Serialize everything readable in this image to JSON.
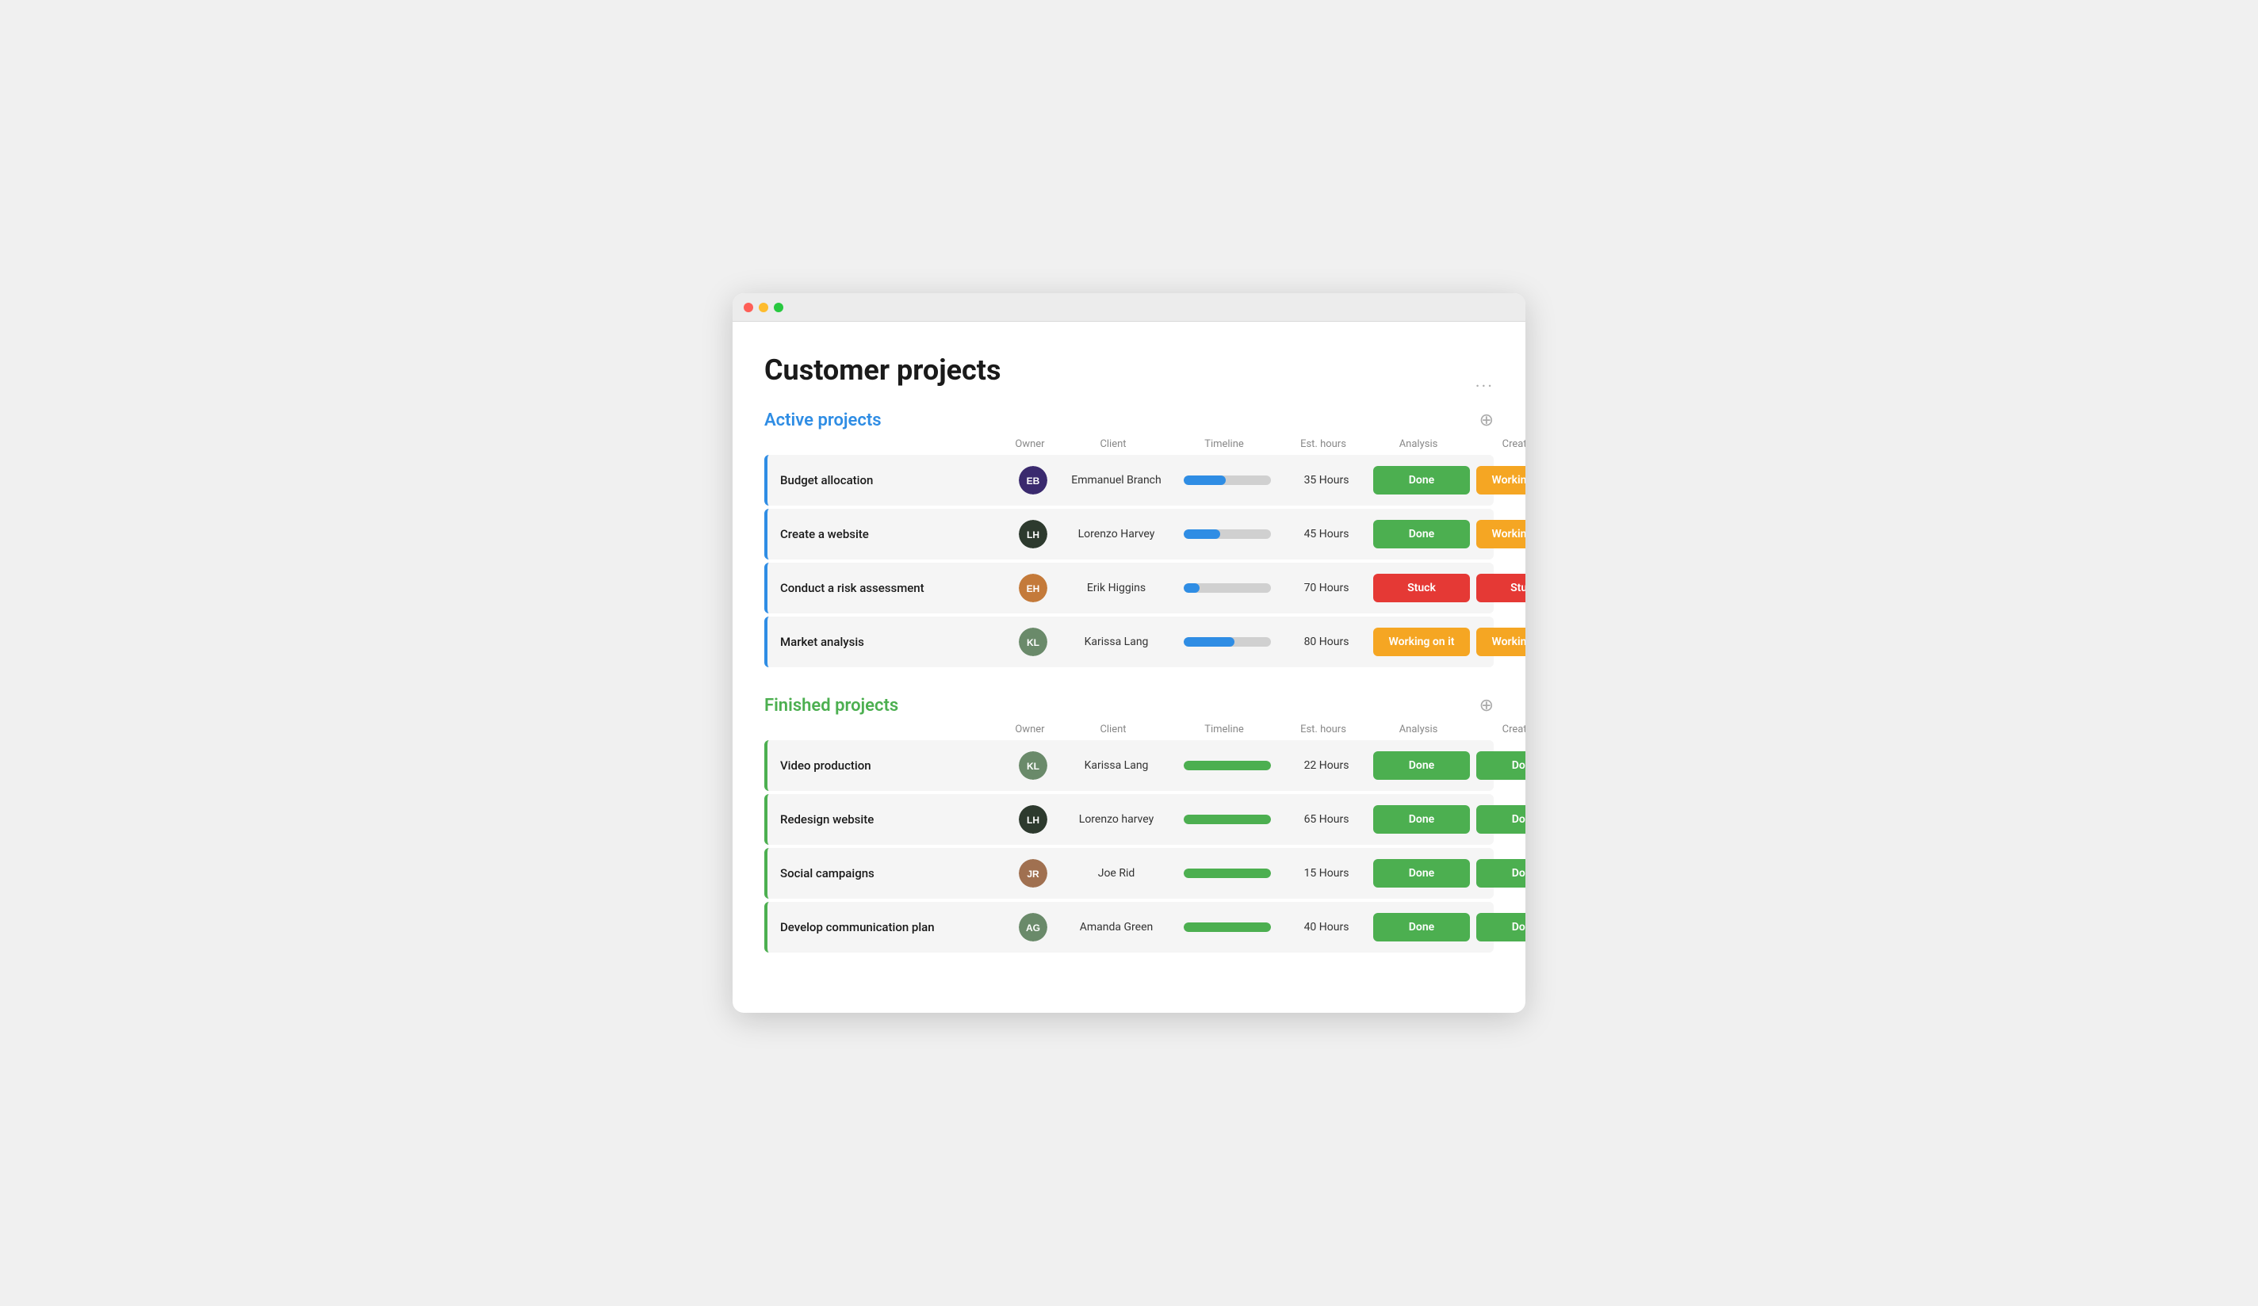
{
  "window": {
    "title": "Customer projects"
  },
  "header": {
    "title": "Customer projects",
    "more_label": "···"
  },
  "active_section": {
    "title": "Active projects",
    "columns": [
      "",
      "Owner",
      "Client",
      "Timeline",
      "Est. hours",
      "Analysis",
      "Creation",
      ""
    ],
    "rows": [
      {
        "name": "Budget allocation",
        "client": "Emmanuel Branch",
        "timeline_pct": 48,
        "est_hours": "35 Hours",
        "analysis": "Done",
        "creation": "Working on it",
        "avatar_color": "#3a2a6e",
        "avatar_initials": "EB"
      },
      {
        "name": "Create a website",
        "client": "Lorenzo Harvey",
        "timeline_pct": 42,
        "est_hours": "45 Hours",
        "analysis": "Done",
        "creation": "Working on it",
        "avatar_color": "#2d3a2e",
        "avatar_initials": "LH"
      },
      {
        "name": "Conduct a risk assessment",
        "client": "Erik Higgins",
        "timeline_pct": 18,
        "est_hours": "70 Hours",
        "analysis": "Stuck",
        "creation": "Stuck",
        "avatar_color": "#c47a3a",
        "avatar_initials": "EH"
      },
      {
        "name": "Market analysis",
        "client": "Karissa Lang",
        "timeline_pct": 58,
        "est_hours": "80 Hours",
        "analysis": "Working on it",
        "creation": "Working on it",
        "avatar_color": "#6a8a6a",
        "avatar_initials": "KL"
      }
    ]
  },
  "finished_section": {
    "title": "Finished projects",
    "rows": [
      {
        "name": "Video production",
        "client": "Karissa Lang",
        "timeline_pct": 100,
        "est_hours": "22 Hours",
        "analysis": "Done",
        "creation": "Done",
        "avatar_color": "#6a8a6a",
        "avatar_initials": "KL"
      },
      {
        "name": "Redesign website",
        "client": "Lorenzo harvey",
        "timeline_pct": 100,
        "est_hours": "65 Hours",
        "analysis": "Done",
        "creation": "Done",
        "avatar_color": "#2d3a2e",
        "avatar_initials": "LH"
      },
      {
        "name": "Social campaigns",
        "client": "Joe Rid",
        "timeline_pct": 100,
        "est_hours": "15 Hours",
        "analysis": "Done",
        "creation": "Done",
        "avatar_color": "#a07050",
        "avatar_initials": "JR"
      },
      {
        "name": "Develop communication plan",
        "client": "Amanda Green",
        "timeline_pct": 100,
        "est_hours": "40 Hours",
        "analysis": "Done",
        "creation": "Done",
        "avatar_color": "#6a8a6a",
        "avatar_initials": "AG"
      }
    ]
  },
  "status_colors": {
    "Done": "#4caf50",
    "Working on it": "#f5a623",
    "Stuck": "#e53935"
  }
}
